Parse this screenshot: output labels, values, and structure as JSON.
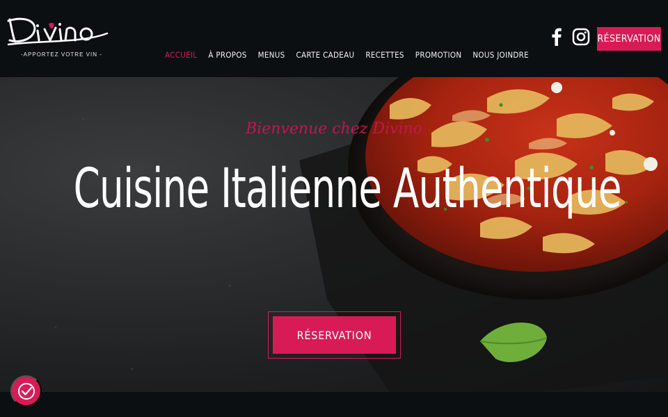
{
  "brand": {
    "name": "Divino",
    "tagline": "-APPORTEZ VOTRE VIN -",
    "accent_color": "#d81b56"
  },
  "nav": {
    "items": [
      {
        "label": "ACCUEIL",
        "active": true
      },
      {
        "label": "À PROPOS",
        "active": false
      },
      {
        "label": "MENUS",
        "active": false
      },
      {
        "label": "CARTE CADEAU",
        "active": false
      },
      {
        "label": "RECETTES",
        "active": false
      },
      {
        "label": "PROMOTION",
        "active": false
      },
      {
        "label": "NOUS JOINDRE",
        "active": false
      }
    ]
  },
  "header": {
    "social": [
      {
        "icon": "facebook-icon"
      },
      {
        "icon": "instagram-icon"
      }
    ],
    "cta_label": "RÉSERVATION"
  },
  "hero": {
    "welcome": "Bienvenue chez Divino",
    "headline": "Cuisine Italienne Authentique",
    "cta_label": "RÉSERVATION"
  },
  "cookie": {
    "icon": "cookie-consent-icon"
  }
}
